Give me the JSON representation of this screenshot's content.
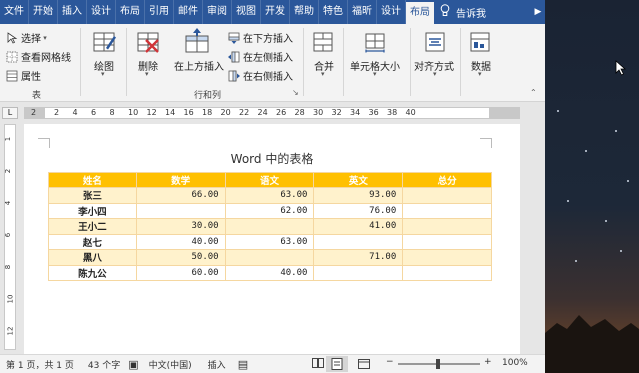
{
  "tabs": [
    "文件",
    "开始",
    "插入",
    "设计",
    "布局",
    "引用",
    "邮件",
    "审阅",
    "视图",
    "开发",
    "帮助",
    "特色",
    "福昕",
    "设计",
    "布局"
  ],
  "active_tab_index": 14,
  "tell_me": "告诉我",
  "ribbon": {
    "select": "选择",
    "view_gridlines": "查看网格线",
    "properties": "属性",
    "group_table": "表",
    "draw": "绘图",
    "delete": "删除",
    "insert_above": "在上方插入",
    "insert_below": "在下方插入",
    "insert_left": "在左侧插入",
    "insert_right": "在右侧插入",
    "group_rows_cols": "行和列",
    "merge": "合并",
    "cell_size": "单元格大小",
    "alignment": "对齐方式",
    "data": "数据"
  },
  "ruler": {
    "numbers": [
      "2",
      "2",
      "4",
      "6",
      "8",
      "10",
      "12",
      "14",
      "16",
      "18",
      "20",
      "22",
      "24",
      "26",
      "28",
      "30",
      "32",
      "34",
      "36",
      "38",
      "40"
    ],
    "vertical_numbers": [
      "1",
      "2",
      "4",
      "6",
      "8",
      "10",
      "12"
    ],
    "corner": "L"
  },
  "document": {
    "title": "Word 中的表格",
    "headers": [
      "姓名",
      "数学",
      "语文",
      "英文",
      "总分"
    ],
    "rows": [
      [
        "张三",
        "66.00",
        "63.00",
        "93.00",
        ""
      ],
      [
        "李小四",
        "",
        "62.00",
        "76.00",
        ""
      ],
      [
        "王小二",
        "30.00",
        "",
        "41.00",
        ""
      ],
      [
        "赵七",
        "40.00",
        "63.00",
        "",
        ""
      ],
      [
        "黑八",
        "50.00",
        "",
        "71.00",
        ""
      ],
      [
        "陈九公",
        "60.00",
        "40.00",
        "",
        ""
      ]
    ]
  },
  "status": {
    "page": "第 1 页，共 1 页",
    "words": "43 个字",
    "language": "中文(中国)",
    "insert": "插入",
    "zoom_minus": "−",
    "zoom_plus": "+",
    "zoom": "100%"
  },
  "colors": {
    "ribbon_blue": "#2b579a",
    "table_header": "#ffc000",
    "table_band": "#fff2cc"
  }
}
